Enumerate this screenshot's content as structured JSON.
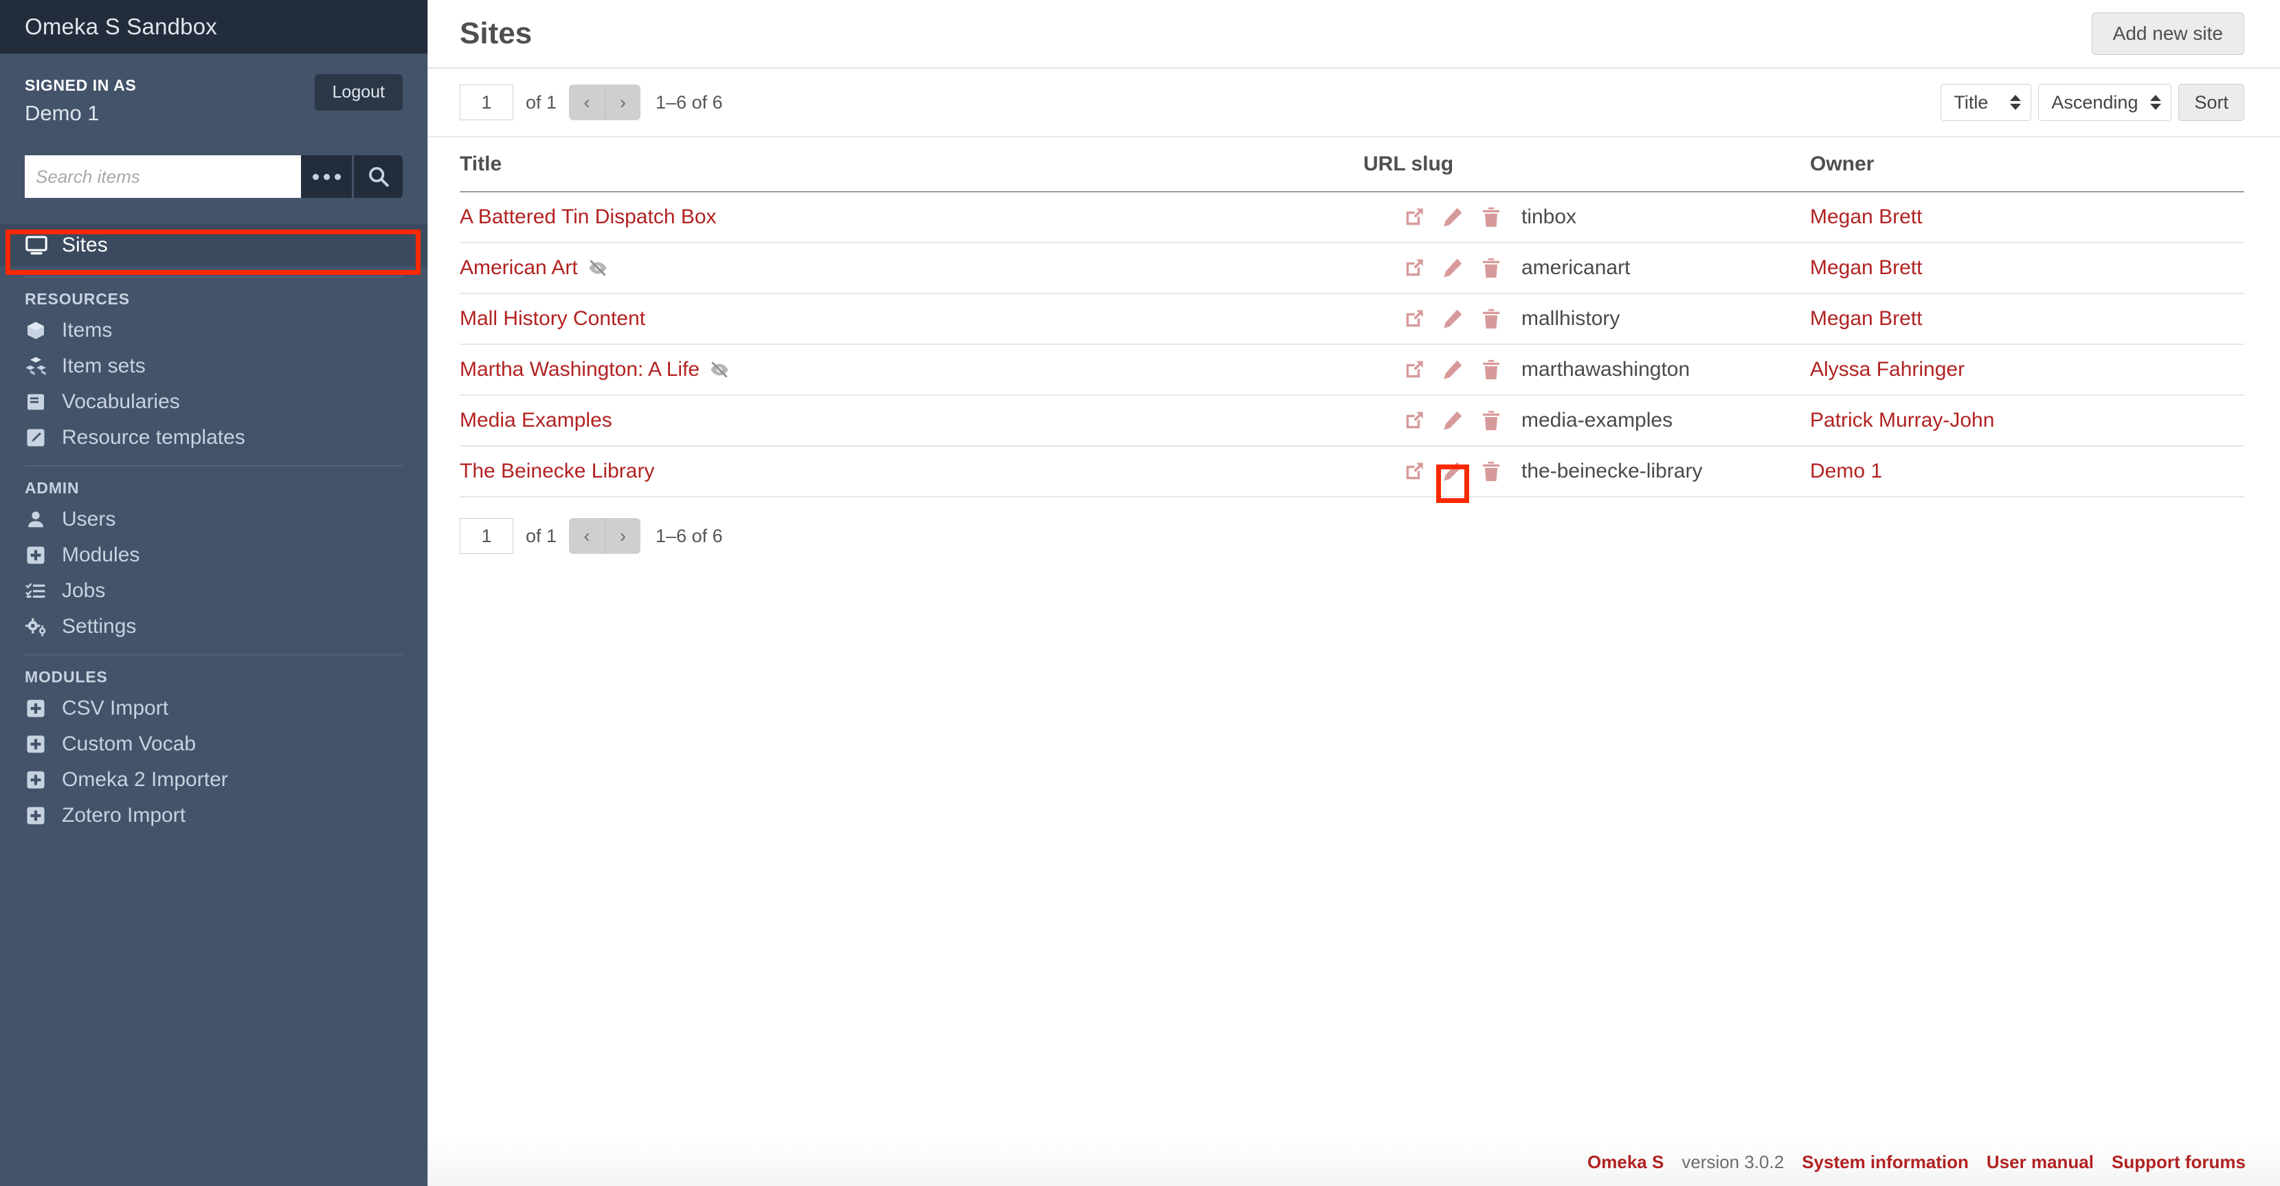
{
  "sidebar": {
    "site_title": "Omeka S Sandbox",
    "signed_in_label": "SIGNED IN AS",
    "user_name": "Demo 1",
    "logout_label": "Logout",
    "search_placeholder": "Search items",
    "search_value": "",
    "active_item": {
      "label": "Sites",
      "icon": "desktop-icon"
    },
    "groups": [
      {
        "label": "RESOURCES",
        "items": [
          {
            "label": "Items",
            "icon": "cube-icon"
          },
          {
            "label": "Item sets",
            "icon": "cubes-icon"
          },
          {
            "label": "Vocabularies",
            "icon": "book-icon"
          },
          {
            "label": "Resource templates",
            "icon": "pencil-square-icon"
          }
        ]
      },
      {
        "label": "ADMIN",
        "items": [
          {
            "label": "Users",
            "icon": "user-icon"
          },
          {
            "label": "Modules",
            "icon": "plus-square-icon"
          },
          {
            "label": "Jobs",
            "icon": "task-list-icon"
          },
          {
            "label": "Settings",
            "icon": "gears-icon"
          }
        ]
      },
      {
        "label": "MODULES",
        "items": [
          {
            "label": "CSV Import",
            "icon": "plus-square-icon"
          },
          {
            "label": "Custom Vocab",
            "icon": "plus-square-icon"
          },
          {
            "label": "Omeka 2 Importer",
            "icon": "plus-square-icon"
          },
          {
            "label": "Zotero Import",
            "icon": "plus-square-icon"
          }
        ]
      }
    ]
  },
  "header": {
    "page_title": "Sites",
    "add_new_site_label": "Add new site"
  },
  "toolbar": {
    "page_value": "1",
    "page_of": "of 1",
    "prev_label": "‹",
    "next_label": "›",
    "result_count": "1–6 of 6",
    "sort_by_value": "Title",
    "sort_dir_value": "Ascending",
    "sort_button_label": "Sort"
  },
  "table": {
    "columns": {
      "title": "Title",
      "slug": "URL slug",
      "owner": "Owner"
    },
    "rows": [
      {
        "title": "A Battered Tin Dispatch Box",
        "private": false,
        "slug": "tinbox",
        "owner": "Megan Brett"
      },
      {
        "title": "American Art",
        "private": true,
        "slug": "americanart",
        "owner": "Megan Brett"
      },
      {
        "title": "Mall History Content",
        "private": false,
        "slug": "mallhistory",
        "owner": "Megan Brett"
      },
      {
        "title": "Martha Washington: A Life",
        "private": true,
        "slug": "marthawashington",
        "owner": "Alyssa Fahringer"
      },
      {
        "title": "Media Examples",
        "private": false,
        "slug": "media-examples",
        "owner": "Patrick Murray-John"
      },
      {
        "title": "The Beinecke Library",
        "private": false,
        "slug": "the-beinecke-library",
        "owner": "Demo 1"
      }
    ],
    "row_action_icons": [
      "external-link-icon",
      "pencil-icon",
      "trash-icon"
    ]
  },
  "bottom_toolbar": {
    "page_value": "1",
    "page_of": "of 1",
    "prev_label": "‹",
    "next_label": "›",
    "result_count": "1–6 of 6"
  },
  "footer": {
    "brand": "Omeka S",
    "version": "version 3.0.2",
    "links": [
      "System information",
      "User manual",
      "Support forums"
    ]
  },
  "annotations": {
    "highlight_color": "#fb2800",
    "sidebar_target": "Sites",
    "row_target": "edit-icon-the-beinecke-library"
  },
  "colors": {
    "sidebar_bg": "#43536a",
    "sidebar_header_bg": "#222c3a",
    "link_red": "#b22222",
    "action_icon": "#d79a9a"
  }
}
